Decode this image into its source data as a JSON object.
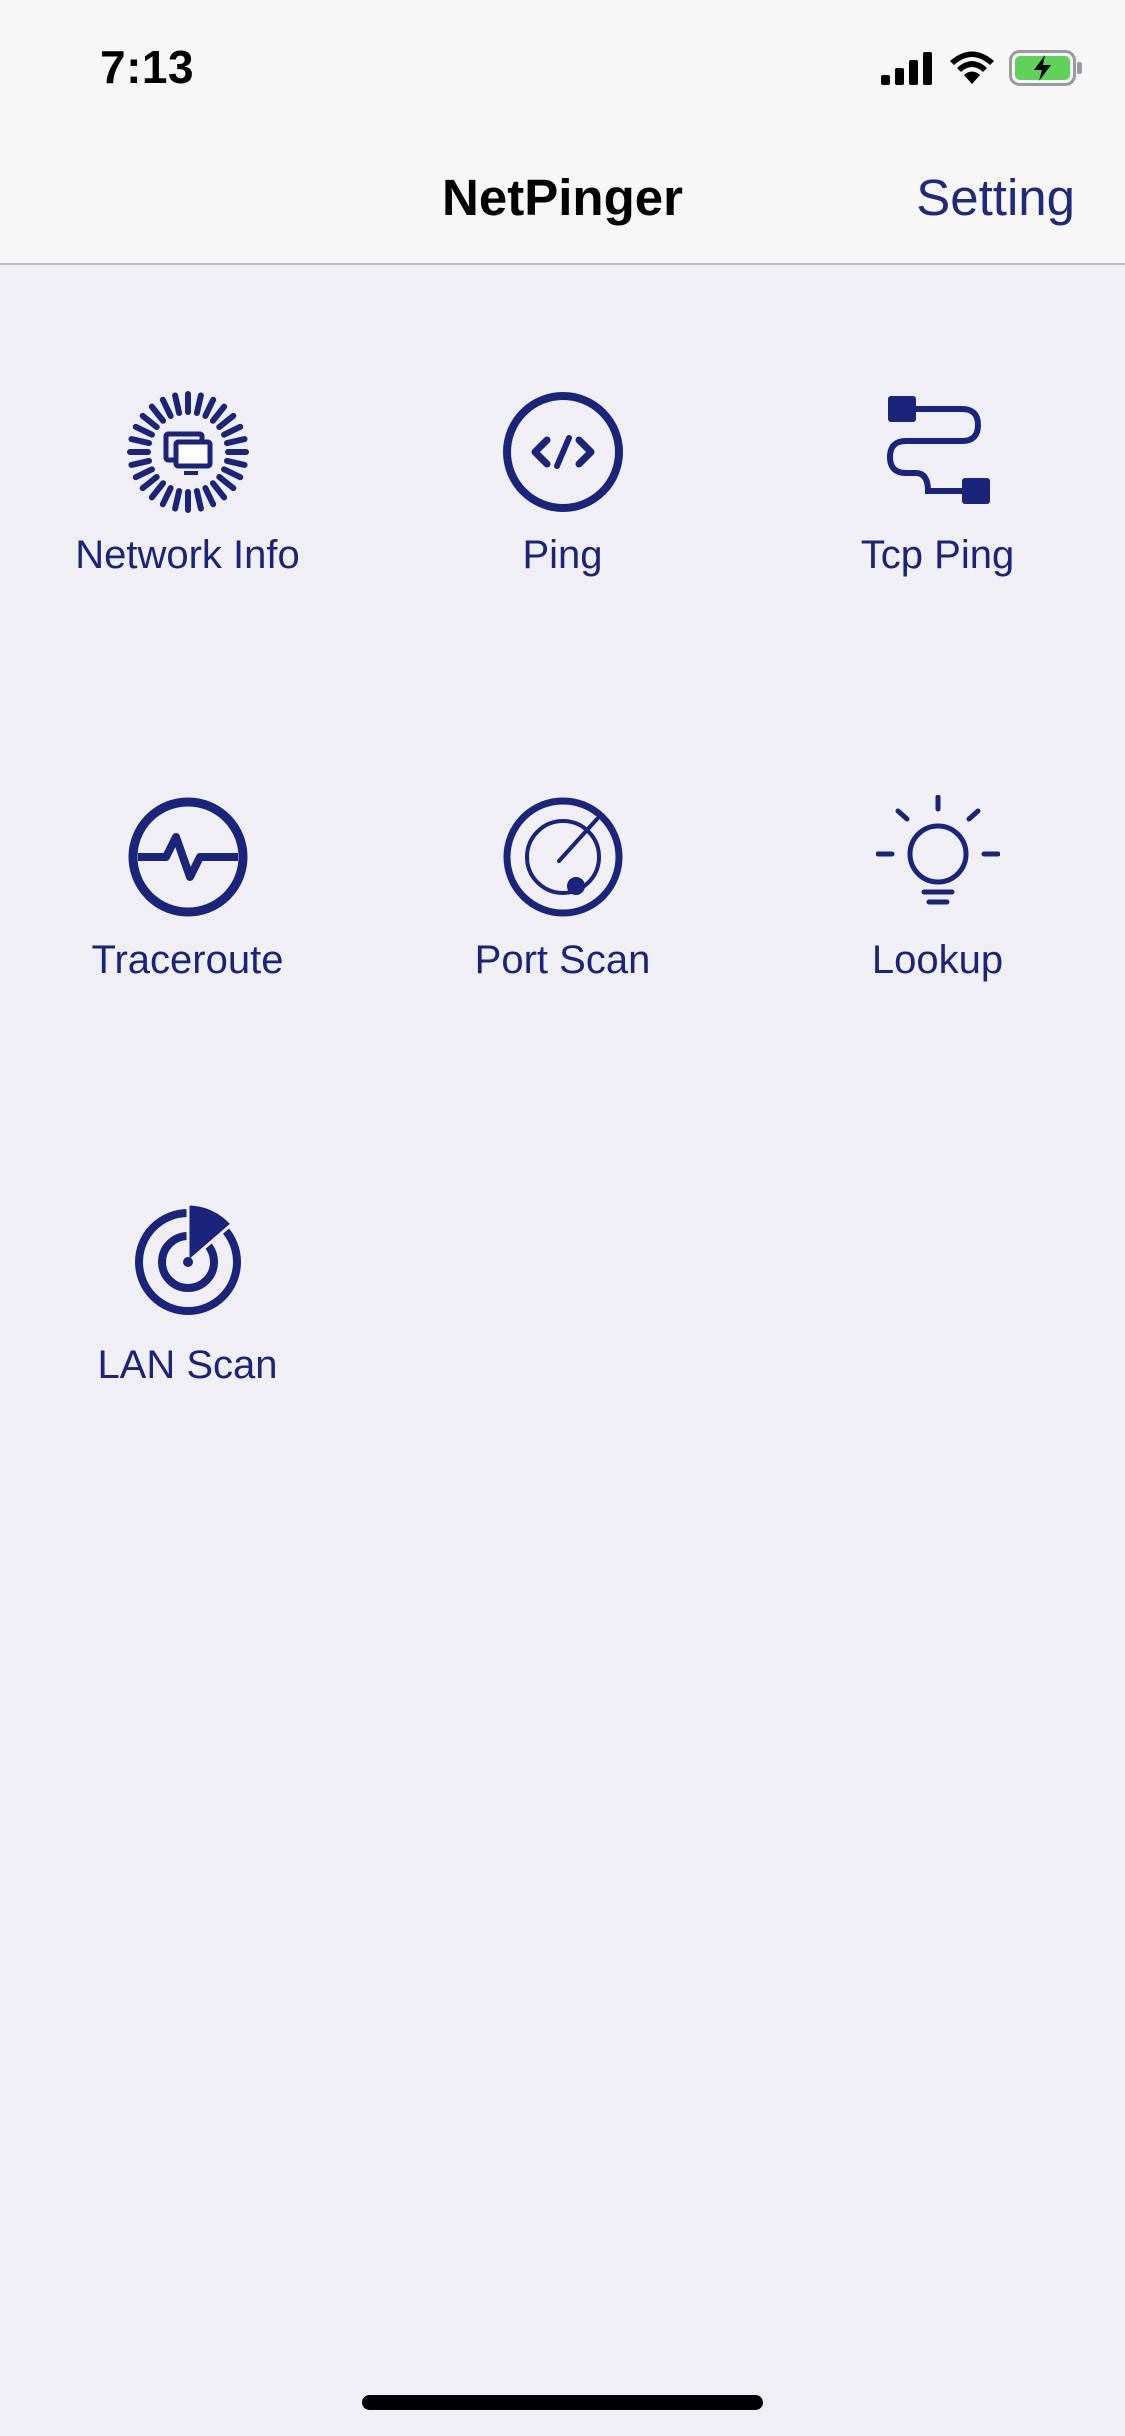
{
  "status": {
    "time": "7:13",
    "icons": [
      "cellular-signal-icon",
      "wifi-icon",
      "battery-charging-icon"
    ]
  },
  "nav": {
    "title": "NetPinger",
    "action": "Setting"
  },
  "colors": {
    "accent": "#1A247A",
    "background": "#EFEFF4",
    "bar": "#F7F7F8",
    "battery": "#5FD25A"
  },
  "tools": [
    {
      "label": "Network Info",
      "icon": "network-info-icon"
    },
    {
      "label": "Ping",
      "icon": "ping-icon"
    },
    {
      "label": "Tcp Ping",
      "icon": "tcp-ping-icon"
    },
    {
      "label": "Traceroute",
      "icon": "traceroute-icon"
    },
    {
      "label": "Port Scan",
      "icon": "port-scan-icon"
    },
    {
      "label": "Lookup",
      "icon": "lookup-icon"
    },
    {
      "label": "LAN Scan",
      "icon": "lan-scan-icon"
    }
  ]
}
